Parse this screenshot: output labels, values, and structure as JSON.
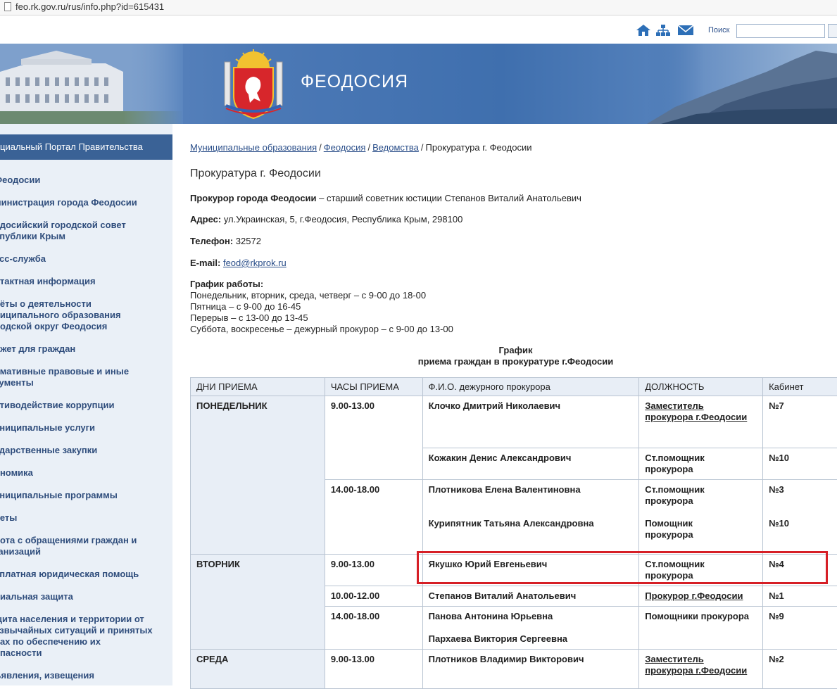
{
  "browser": {
    "url": "feo.rk.gov.ru/rus/info.php?id=615431"
  },
  "header": {
    "search_label": "Поиск",
    "search_value": "",
    "city_title": "ФЕОДОСИЯ",
    "icons": [
      "home-icon",
      "sitemap-icon",
      "mail-icon"
    ]
  },
  "sidebar": {
    "portal_label": "циальный Портал Правительства",
    "items": [
      "Феодосии",
      "министрация города Феодосии",
      "одосийский городской совет\nспублики Крым",
      "есс-служба",
      "нтактная информация",
      "нёты о деятельности\nниципального образования\nродской округ Феодосия",
      "джет для граждан",
      "рмативные правовые и иные\nкументы",
      "отиводействие коррупции",
      "униципальные услуги",
      "ударственные закупки",
      "ономика",
      "униципальные программы",
      "неты",
      "бота с обращениями граждан и\nганизаций",
      "сплатная юридическая помощь",
      "циальная защита",
      "щита населения и территории от\nезвычайных ситуаций и принятых\nрах по обеспечению их\nопасности",
      "ъявления, извещения"
    ]
  },
  "breadcrumbs": {
    "items": [
      "Муниципальные образования",
      "Феодосия",
      "Ведомства"
    ],
    "separator": "/",
    "current": "Прокуратура г. Феодосии"
  },
  "page": {
    "title": "Прокуратура г. Феодосии",
    "prosecutor_label": "Прокурор города Феодосии",
    "prosecutor_text": " – старший советник юстиции Степанов Виталий Анатольевич",
    "address_label": "Адрес:",
    "address_text": " ул.Украинская, 5, г.Феодосия, Республика Крым, 298100",
    "phone_label": "Телефон:",
    "phone_text": " 32572",
    "email_label": "E-mail:",
    "email_link": "feod@rkprok.ru",
    "schedule_label": "График работы:",
    "schedule_lines": [
      "Понедельник, вторник, среда, четверг – с 9-00 до 18-00",
      "Пятница – с 9-00 до 16-45",
      "Перерыв – с 13-00 до 13-45",
      "Суббота, воскресенье – дежурный прокурор – с 9-00 до 13-00"
    ],
    "table_title_1": "График",
    "table_title_2": "приема граждан в прокуратуре г.Феодосии"
  },
  "table": {
    "headers": [
      "ДНИ ПРИЕМА",
      "ЧАСЫ ПРИЕМА",
      "Ф.И.О. дежурного прокурора",
      "ДОЛЖНОСТЬ",
      "Кабинет"
    ],
    "day_mon": "ПОНЕДЕЛЬНИК",
    "day_tue": "ВТОРНИК",
    "day_wed": "СРЕДА",
    "h_mon_1": "9.00-13.00",
    "h_mon_2": "14.00-18.00",
    "h_tue_1": "9.00-13.00",
    "h_tue_2": "10.00-12.00",
    "h_tue_3": "14.00-18.00",
    "h_wed_1": "9.00-13.00",
    "r1_name": "Клочко Дмитрий Николаевич",
    "r1_pos": "Заместитель\nпрокурора г.Феодосии",
    "r1_room": "№7",
    "r2_name": "Кожакин Денис Александрович",
    "r2_pos": "Ст.помощник\nпрокурора",
    "r2_room": "№10",
    "r3_name_a": "Плотникова Елена Валентиновна",
    "r3_name_b": "Курипятник Татьяна Александровна",
    "r3_pos_a": "Ст.помощник\nпрокурора",
    "r3_pos_b": "Помощник\nпрокурора",
    "r3_room_a": "№3",
    "r3_room_b": "№10",
    "r4_name": "Якушко Юрий Евгеньевич",
    "r4_pos": "Ст.помощник\nпрокурора",
    "r4_room": "№4",
    "r5_name": "Степанов Виталий Анатольевич",
    "r5_pos": "Прокурор г.Феодосии",
    "r5_room": "№1",
    "r6_name_a": "Панова Антонина Юрьевна",
    "r6_name_b": "Пархаева Виктория Сергеевна",
    "r6_pos": "Помощники прокурора",
    "r6_room": "№9",
    "r7_name": "Плотников Владимир Викторович",
    "r7_pos": "Заместитель\nпрокурора г.Феодосии",
    "r7_room": "№2"
  },
  "colors": {
    "banner": "#4c79b6",
    "sidebar_bg": "#eaf0f7",
    "portal_bar": "#3a6296",
    "link": "#2b4f8a",
    "highlight": "#d61f26"
  }
}
